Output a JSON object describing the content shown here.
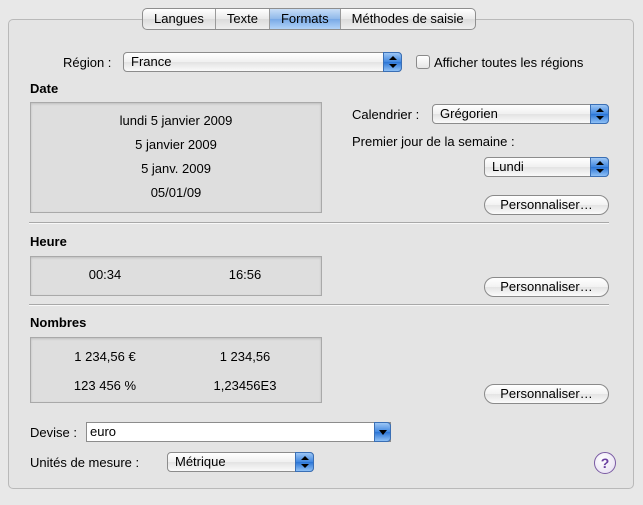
{
  "tabs": [
    {
      "label": "Langues",
      "active": false
    },
    {
      "label": "Texte",
      "active": false
    },
    {
      "label": "Formats",
      "active": true
    },
    {
      "label": "Méthodes de saisie",
      "active": false
    }
  ],
  "region": {
    "label": "Région :",
    "value": "France",
    "show_all_label": "Afficher toutes les régions",
    "show_all_checked": false
  },
  "date": {
    "heading": "Date",
    "samples": [
      "lundi 5 janvier 2009",
      "5 janvier 2009",
      "5 janv. 2009",
      "05/01/09"
    ],
    "calendar_label": "Calendrier :",
    "calendar_value": "Grégorien",
    "first_day_label": "Premier jour de la semaine :",
    "first_day_value": "Lundi",
    "customize_label": "Personnaliser…"
  },
  "time": {
    "heading": "Heure",
    "samples": [
      "00:34",
      "16:56"
    ],
    "customize_label": "Personnaliser…"
  },
  "numbers": {
    "heading": "Nombres",
    "samples": [
      "1 234,56 €",
      "1 234,56",
      "123 456 %",
      "1,23456E3"
    ],
    "customize_label": "Personnaliser…"
  },
  "currency": {
    "label": "Devise :",
    "value": "euro"
  },
  "units": {
    "label": "Unités de mesure :",
    "value": "Métrique"
  },
  "help": {
    "label": "?"
  },
  "colors": {
    "accent": "#3f86e0",
    "tab_active": "#8fb8ea",
    "panel_bg": "#e4e4e4",
    "help_accent": "#6a3fa0"
  }
}
